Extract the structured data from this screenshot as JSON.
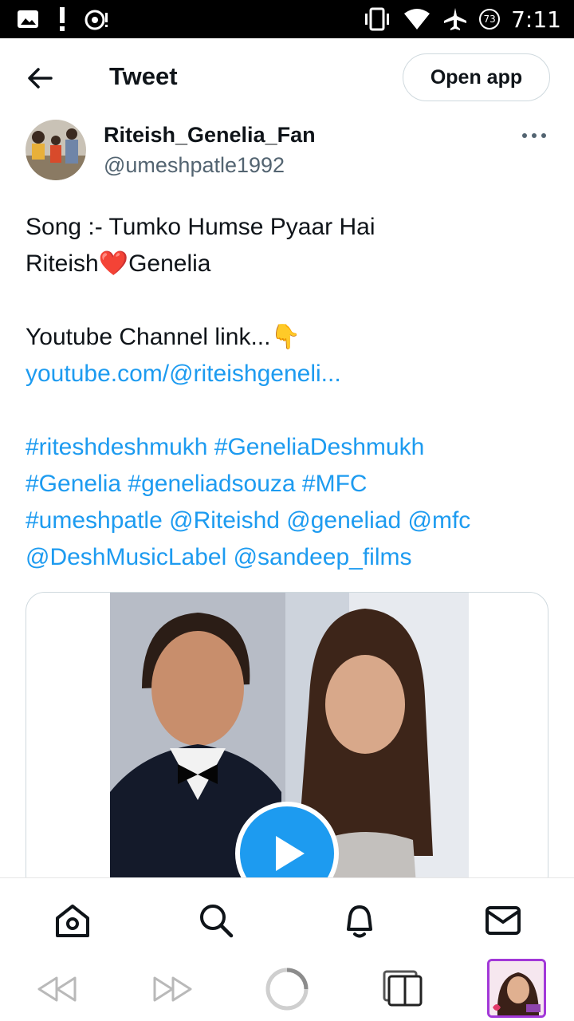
{
  "status_bar": {
    "time": "7:11",
    "badge": "73",
    "icons": [
      "image-icon",
      "alert-icon",
      "media-icon",
      "vibrate-icon",
      "wifi-icon",
      "airplane-icon",
      "data-saver-icon"
    ]
  },
  "header": {
    "title": "Tweet",
    "open_app": "Open app",
    "back_icon": "back-arrow-icon"
  },
  "author": {
    "name": "Riteish_Genelia_Fan",
    "handle": "@umeshpatle1992"
  },
  "tweet": {
    "line1": "Song :- Tumko Humse Pyaar Hai",
    "line2_a": "Riteish",
    "line2_heart": "❤️",
    "line2_b": "Genelia",
    "line3": "Youtube Channel link...",
    "line3_emoji": "👇",
    "link": "youtube.com/@riteishgeneli...",
    "tags_line1": "#riteshdeshmukh #GeneliaDeshmukh",
    "tags_line2": "#Genelia #geneliadsouza #MFC",
    "tags_line3": "#umeshpatle @Riteishd @geneliad @mfc",
    "tags_line4": "@DeshMusicLabel @sandeep_films"
  },
  "bottom_nav": [
    "home-icon",
    "search-icon",
    "notifications-icon",
    "messages-icon"
  ],
  "browser_bar": [
    "rewind-icon",
    "fast-forward-icon",
    "loading-icon",
    "tabs-icon",
    "tab-thumbnail"
  ],
  "colors": {
    "accent": "#1d9bf0",
    "text": "#0f1419",
    "secondary": "#536471",
    "border": "#cfd9de",
    "thumb_border": "#a238d8"
  }
}
